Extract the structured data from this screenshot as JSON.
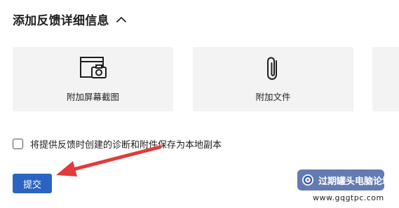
{
  "section": {
    "title": "添加反馈详细信息",
    "chevron_icon": "chevron-up-icon"
  },
  "tiles": [
    {
      "label": "附加屏幕截图",
      "icon": "screenshot-icon"
    },
    {
      "label": "附加文件",
      "icon": "paperclip-icon"
    },
    {
      "label": "",
      "icon": ""
    }
  ],
  "checkbox": {
    "label": "将提供反馈时创建的诊断和附件保存为本地副本",
    "checked": false
  },
  "submit": {
    "label": "提交"
  },
  "annotation": {
    "arrow_color": "#e23b3b"
  },
  "watermark": {
    "text": "过期罐头电脑论坛",
    "url": "www.gqgtpc.com"
  },
  "colors": {
    "accent": "#2b63c2",
    "tile_bg": "#f3f3f3"
  }
}
